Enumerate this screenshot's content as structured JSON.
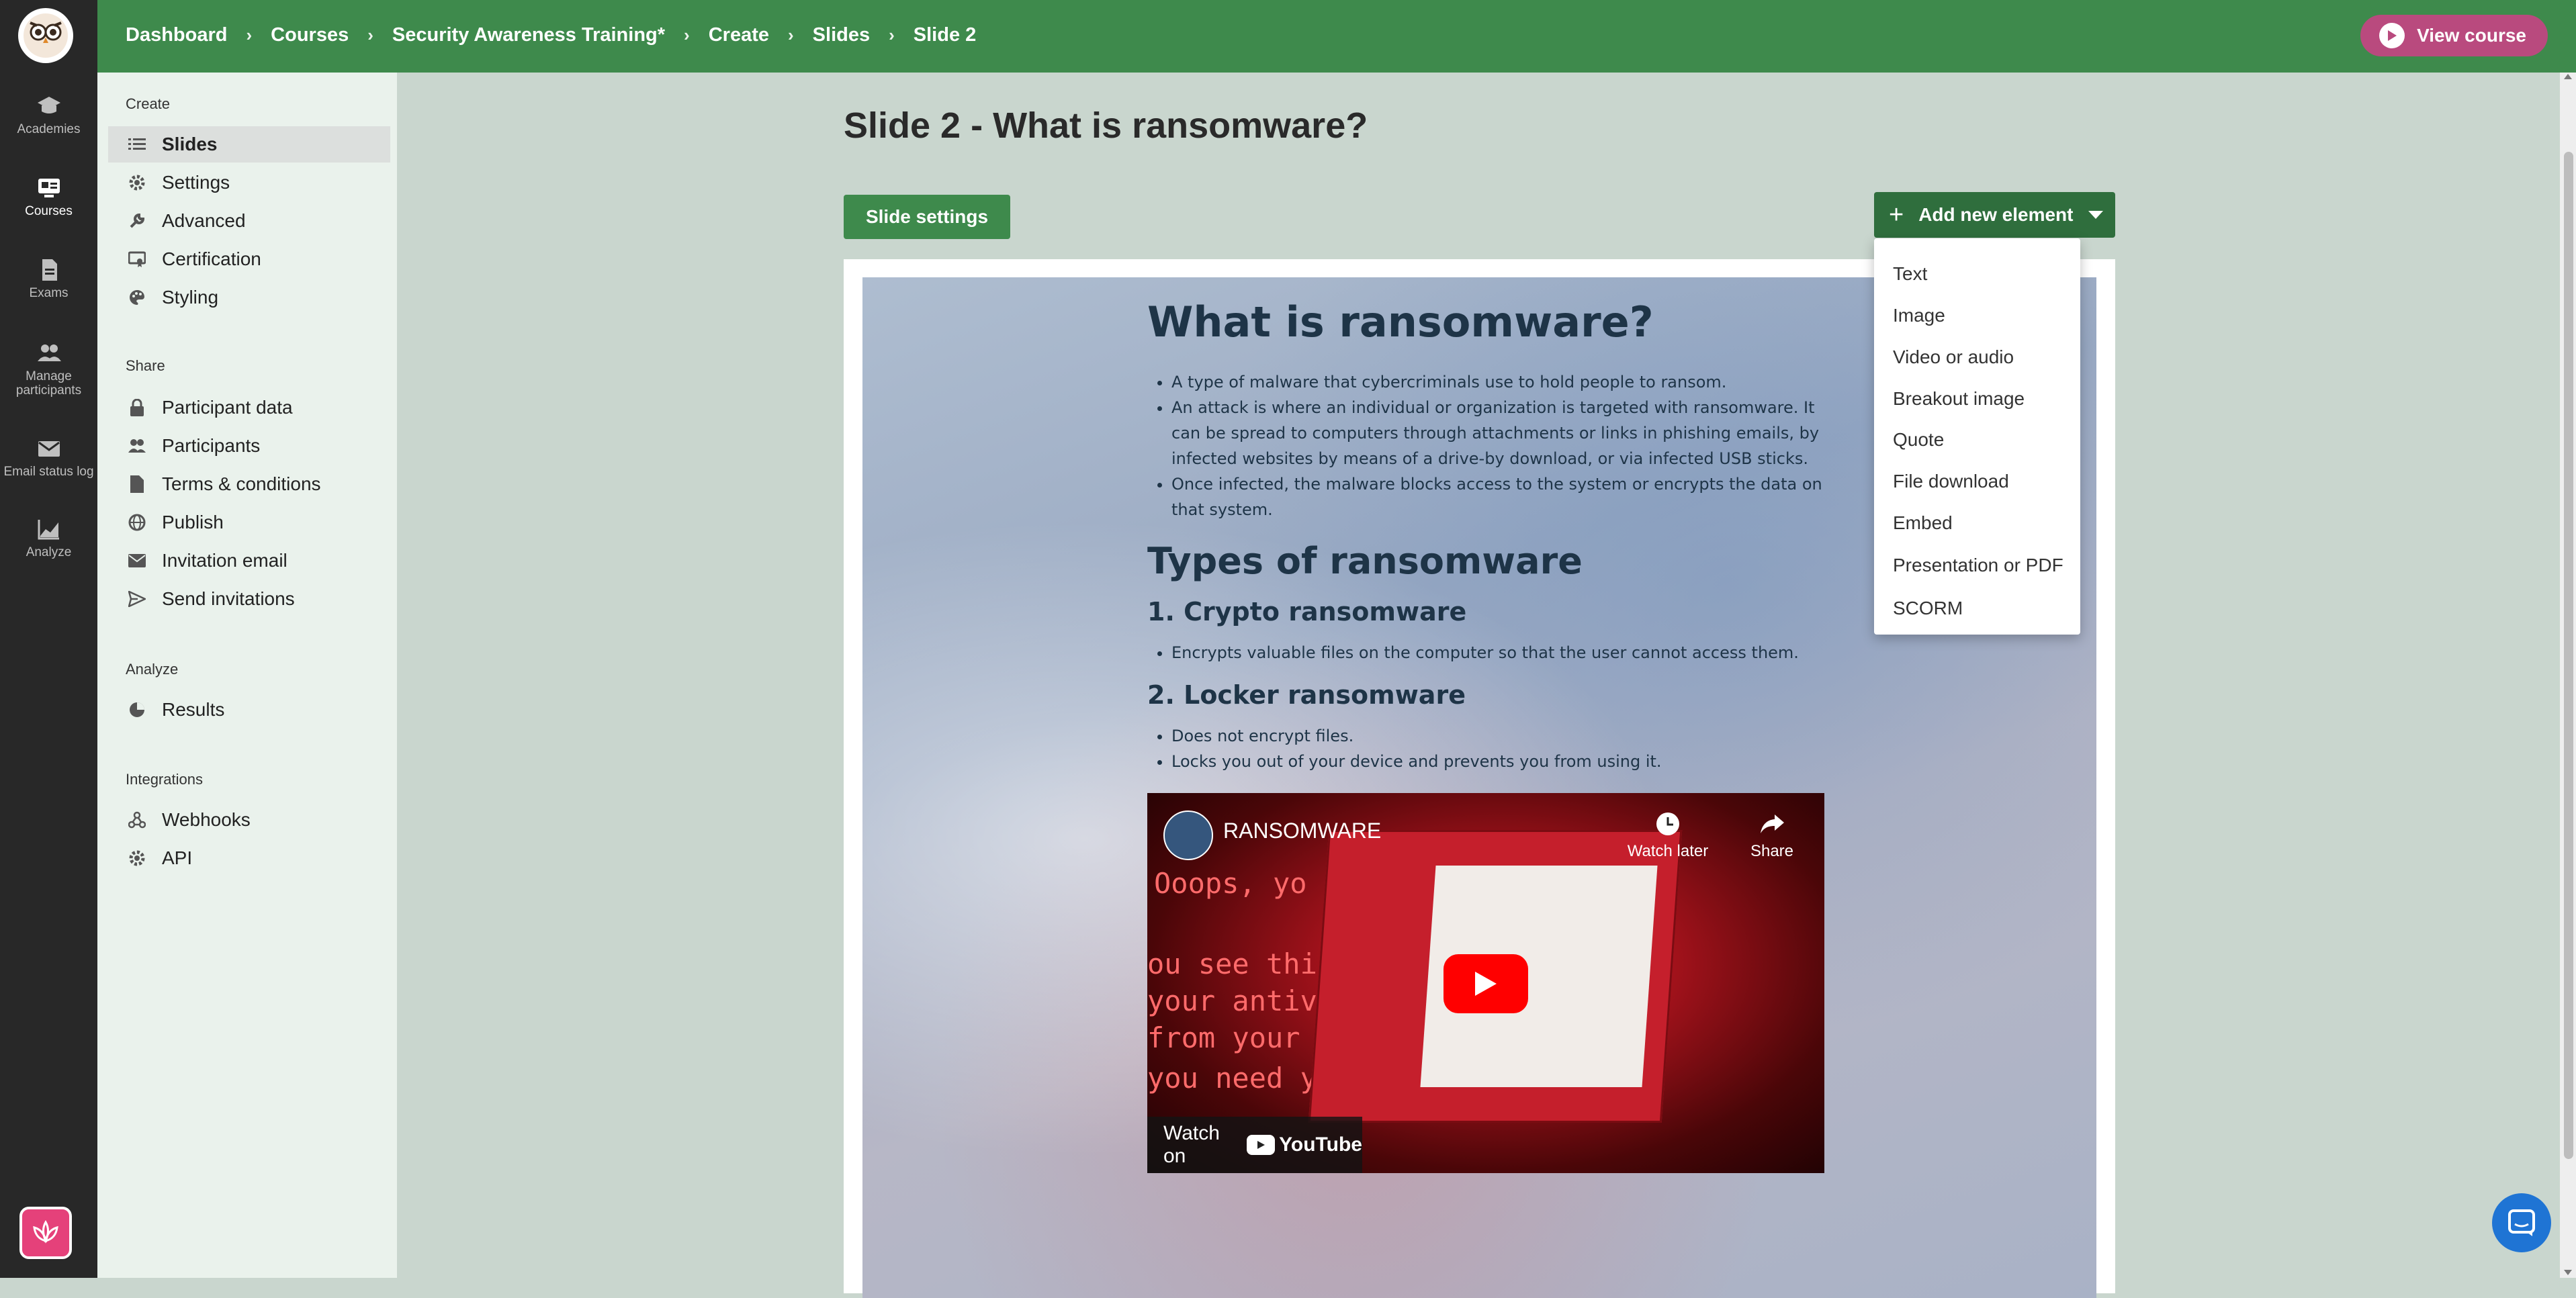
{
  "rail": {
    "items": [
      {
        "label": "Academies",
        "icon": "graduation-cap-icon"
      },
      {
        "label": "Courses",
        "icon": "courses-icon"
      },
      {
        "label": "Exams",
        "icon": "document-icon"
      },
      {
        "label": "Manage participants",
        "icon": "people-icon"
      },
      {
        "label": "Email status log",
        "icon": "mail-icon"
      },
      {
        "label": "Analyze",
        "icon": "chart-icon"
      }
    ],
    "active": "Courses"
  },
  "breadcrumb": [
    "Dashboard",
    "Courses",
    "Security Awareness Training*",
    "Create",
    "Slides",
    "Slide 2"
  ],
  "header": {
    "view_course": "View course"
  },
  "sidebar": {
    "sections": [
      {
        "label": "Create",
        "items": [
          "Slides",
          "Settings",
          "Advanced",
          "Certification",
          "Styling"
        ]
      },
      {
        "label": "Share",
        "items": [
          "Participant data",
          "Participants",
          "Terms & conditions",
          "Publish",
          "Invitation email",
          "Send invitations"
        ]
      },
      {
        "label": "Analyze",
        "items": [
          "Results"
        ]
      },
      {
        "label": "Integrations",
        "items": [
          "Webhooks",
          "API"
        ]
      }
    ],
    "active_item": "Slides"
  },
  "main": {
    "title": "Slide 2 - What is ransomware?",
    "slide_settings": "Slide settings",
    "add_new_element": "Add new element",
    "dropdown": [
      "Text",
      "Image",
      "Video or audio",
      "Breakout image",
      "Quote",
      "File download",
      "Embed",
      "Presentation or PDF",
      "SCORM"
    ]
  },
  "slide": {
    "heading": "What is ransomware?",
    "bullets1": [
      "A type of malware that cybercriminals use to hold people to ransom.",
      "An attack is where an individual or organization is targeted with ransomware. It can be spread to computers through attachments or links in phishing emails, by infected websites by means of a drive-by download, or via infected USB sticks.",
      "Once infected, the malware blocks access to the system or encrypts the data on that system."
    ],
    "types_heading": "Types of ransomware",
    "crypto_heading": "1. Crypto ransomware",
    "crypto_bullets": [
      "Encrypts valuable files on the computer so that the user cannot access them."
    ],
    "locker_heading": "2. Locker ransomware",
    "locker_bullets": [
      "Does not encrypt files.",
      "Locks you out of your device and prevents you from using it."
    ],
    "video": {
      "title": "RANSOMWARE",
      "watch_later": "Watch later",
      "share": "Share",
      "watch_on": "Watch on",
      "youtube": "YouTube",
      "screen_text": [
        "Ooops, yo",
        "ou see this",
        "your antivi",
        "from your comp",
        "you need your"
      ]
    }
  },
  "colors": {
    "topbar": "#3e8a4c",
    "rail": "#282828",
    "sidebar": "#eaf2ec",
    "view_course": "#b94a7e",
    "primary_button": "#3e8a4c"
  }
}
